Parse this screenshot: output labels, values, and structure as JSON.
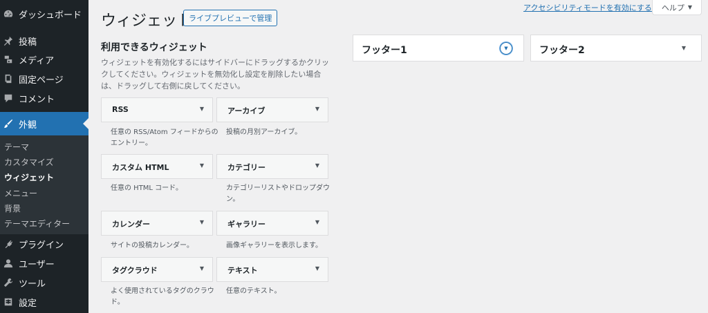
{
  "sidebar": {
    "menu": [
      {
        "label": "ダッシュボード",
        "icon": "dashboard-icon"
      },
      {
        "label": "投稿",
        "icon": "pin-icon"
      },
      {
        "label": "メディア",
        "icon": "media-icon"
      },
      {
        "label": "固定ページ",
        "icon": "page-icon"
      },
      {
        "label": "コメント",
        "icon": "comment-icon"
      },
      {
        "label": "外観",
        "icon": "brush-icon"
      },
      {
        "label": "プラグイン",
        "icon": "plugin-icon"
      },
      {
        "label": "ユーザー",
        "icon": "user-icon"
      },
      {
        "label": "ツール",
        "icon": "wrench-icon"
      },
      {
        "label": "設定",
        "icon": "settings-icon"
      }
    ],
    "submenu": [
      "テーマ",
      "カスタマイズ",
      "ウィジェット",
      "メニュー",
      "背景",
      "テーマエディター"
    ],
    "active_color": "#2271b1"
  },
  "header": {
    "title": "ウィジェット",
    "live_preview": "ライブプレビューで管理",
    "a11y_link": "アクセシビリティモードを有効にする",
    "help": "ヘルプ"
  },
  "available": {
    "title": "利用できるウィジェット",
    "desc": "ウィジェットを有効化するにはサイドバーにドラッグするかクリックしてください。ウィジェットを無効化し設定を削除したい場合は、ドラッグして右側に戻してください。",
    "widgets": [
      {
        "title": "RSS",
        "desc": "任意の RSS/Atom フィードからのエントリー。"
      },
      {
        "title": "アーカイブ",
        "desc": "投稿の月別アーカイブ。"
      },
      {
        "title": "カスタム HTML",
        "desc": "任意の HTML コード。"
      },
      {
        "title": "カテゴリー",
        "desc": "カテゴリーリストやドロップダウン。"
      },
      {
        "title": "カレンダー",
        "desc": "サイトの投稿カレンダー。"
      },
      {
        "title": "ギャラリー",
        "desc": "画像ギャラリーを表示します。"
      },
      {
        "title": "タグクラウド",
        "desc": "よく使用されているタグのクラウド。"
      },
      {
        "title": "テキスト",
        "desc": "任意のテキスト。"
      }
    ]
  },
  "areas": [
    {
      "title": "フッター1"
    },
    {
      "title": "フッター2"
    }
  ]
}
